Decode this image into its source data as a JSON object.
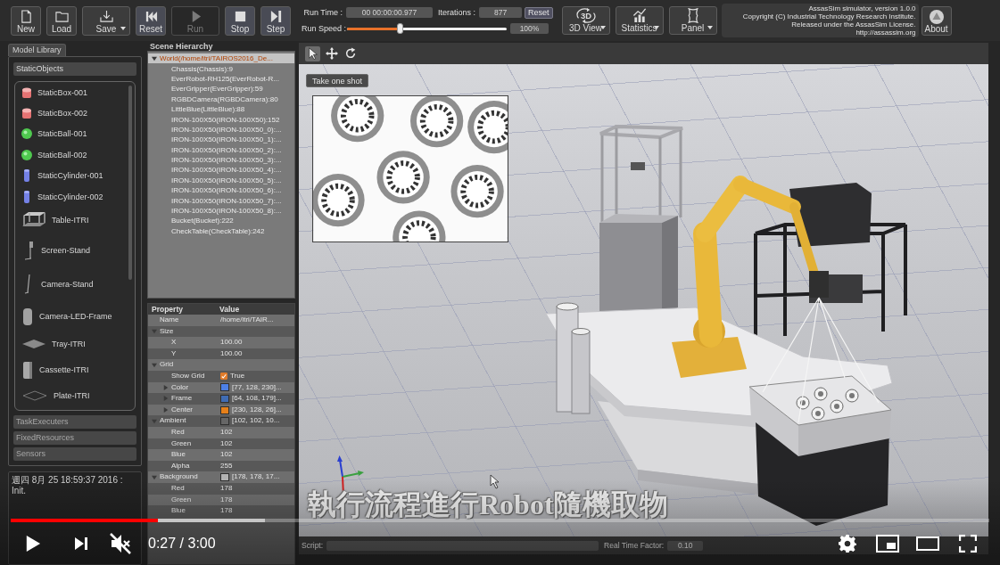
{
  "toolbar": {
    "buttons": [
      {
        "kind": "new",
        "label": "New",
        "menu": false,
        "disabled": false
      },
      {
        "kind": "load",
        "label": "Load",
        "menu": false,
        "disabled": false
      },
      {
        "kind": "save",
        "label": "Save",
        "menu": true,
        "disabled": false
      },
      {
        "kind": "reset",
        "label": "Reset",
        "menu": false,
        "disabled": false
      },
      {
        "kind": "run",
        "label": "Run",
        "menu": false,
        "disabled": true
      },
      {
        "kind": "stop",
        "label": "Stop",
        "menu": false,
        "disabled": false
      },
      {
        "kind": "step",
        "label": "Step",
        "menu": false,
        "disabled": false
      }
    ],
    "run_time": {
      "label": "Run Time :",
      "value": "00 00:00:00.977"
    },
    "iterations": {
      "label": "Iterations :",
      "value": "877"
    },
    "reset_button": "Reset",
    "run_speed": {
      "label": "Run Speed :",
      "level": 0.33,
      "value": "100%"
    },
    "view_buttons": [
      {
        "kind": "view",
        "label": "3D View",
        "icon_text": "3D",
        "menu": true
      },
      {
        "kind": "statistics",
        "label": "Statistics",
        "menu": true
      },
      {
        "kind": "panel",
        "label": "Panel",
        "menu": true
      }
    ],
    "info_lines": [
      "AssasSim simulator, version 1.0.0",
      "Copyright (C) Industrial Technology Research Institute.",
      "Released under the AssasSim License.",
      "http://assassim.org"
    ],
    "about_button": "About"
  },
  "model_library": {
    "tab": "Model Library",
    "sections": [
      {
        "title": "StaticObjects",
        "expanded": true,
        "items": [
          {
            "kind": "box",
            "label": "StaticBox-001"
          },
          {
            "kind": "box",
            "label": "StaticBox-002"
          },
          {
            "kind": "ball",
            "label": "StaticBall-001"
          },
          {
            "kind": "ball",
            "label": "StaticBall-002"
          },
          {
            "kind": "cylinder",
            "label": "StaticCylinder-001"
          },
          {
            "kind": "cylinder",
            "label": "StaticCylinder-002"
          },
          {
            "kind": "table",
            "label": "Table-ITRI"
          },
          {
            "kind": "screen-stand",
            "label": "Screen-Stand"
          },
          {
            "kind": "camera-stand",
            "label": "Camera-Stand"
          },
          {
            "kind": "frame",
            "label": "Camera-LED-Frame"
          },
          {
            "kind": "tray",
            "label": "Tray-ITRI"
          },
          {
            "kind": "cassette",
            "label": "Cassette-ITRI"
          },
          {
            "kind": "plate",
            "label": "Plate-ITRI"
          }
        ]
      },
      {
        "title": "TaskExecuters",
        "expanded": false
      },
      {
        "title": "FixedResources",
        "expanded": false
      },
      {
        "title": "Sensors",
        "expanded": false
      }
    ]
  },
  "log": [
    "週四 8月 25 18:59:37 2016 : Init."
  ],
  "scene_hierarchy": {
    "title": "Scene Hierarchy",
    "tree": [
      {
        "label": "World(/home/itri/TAIROS2016_De...",
        "selected": true,
        "expanded": true,
        "children": [
          {
            "label": "Chassis(Chassis):9",
            "selected": false
          },
          {
            "label": "EverRobot-RH125(EverRobot-R...",
            "selected": false
          },
          {
            "label": "EverGripper(EverGripper):59",
            "selected": false
          },
          {
            "label": "RGBDCamera(RGBDCamera):80",
            "selected": false
          },
          {
            "label": "LittleBlue(LittleBlue):88",
            "selected": false
          },
          {
            "label": "IRON-100X50(IRON-100X50):152",
            "selected": false
          },
          {
            "label": "IRON-100X50(IRON-100X50_0):...",
            "selected": false
          },
          {
            "label": "IRON-100X50(IRON-100X50_1):...",
            "selected": false
          },
          {
            "label": "IRON-100X50(IRON-100X50_2):...",
            "selected": false
          },
          {
            "label": "IRON-100X50(IRON-100X50_3):...",
            "selected": false
          },
          {
            "label": "IRON-100X50(IRON-100X50_4):...",
            "selected": false
          },
          {
            "label": "IRON-100X50(IRON-100X50_5):...",
            "selected": false
          },
          {
            "label": "IRON-100X50(IRON-100X50_6):...",
            "selected": false
          },
          {
            "label": "IRON-100X50(IRON-100X50_7):...",
            "selected": false
          },
          {
            "label": "IRON-100X50(IRON-100X50_8):...",
            "selected": false
          },
          {
            "label": "Bucket(Bucket):222",
            "selected": false
          },
          {
            "label": "CheckTable(CheckTable):242",
            "selected": false
          }
        ]
      }
    ]
  },
  "properties": {
    "columns": [
      "Property",
      "Value"
    ],
    "rows": [
      {
        "name": "Name",
        "value": "/home/itri/TAIR..."
      },
      {
        "name": "Size",
        "expanded": true,
        "children": [
          {
            "name": "X",
            "value": "100.00"
          },
          {
            "name": "Y",
            "value": "100.00"
          }
        ]
      },
      {
        "name": "Grid",
        "expanded": true,
        "children": [
          {
            "name": "Show Grid",
            "checked": true,
            "value": "True"
          },
          {
            "name": "Color",
            "expanded": false,
            "color": "#4d80e6",
            "value": "[77, 128, 230]..."
          },
          {
            "name": "Frame",
            "expanded": false,
            "color": "#406cb3",
            "value": "[64, 108, 179]..."
          },
          {
            "name": "Center",
            "expanded": false,
            "color": "#e6801a",
            "value": "[230, 128, 26]..."
          }
        ]
      },
      {
        "name": "Ambient",
        "expanded": true,
        "color": "#666666",
        "value": "[102, 102, 10...",
        "children": [
          {
            "name": "Red",
            "value": "102"
          },
          {
            "name": "Green",
            "value": "102"
          },
          {
            "name": "Blue",
            "value": "102"
          },
          {
            "name": "Alpha",
            "value": "255"
          }
        ]
      },
      {
        "name": "Background",
        "expanded": true,
        "color": "#b2b2b2",
        "value": "[178, 178, 17...",
        "children": [
          {
            "name": "Red",
            "value": "178"
          },
          {
            "name": "Green",
            "value": "178"
          },
          {
            "name": "Blue",
            "value": "178"
          }
        ]
      }
    ]
  },
  "viewport": {
    "tools": [
      {
        "kind": "select",
        "selected": true
      },
      {
        "kind": "move",
        "selected": false
      },
      {
        "kind": "rotate",
        "selected": false
      }
    ],
    "snapshot_button": "Take one shot",
    "caption": "執行流程進行Robot隨機取物",
    "status": {
      "script_label": "Script:",
      "rtf_label": "Real Time Factor:",
      "rtf_value": "0.10"
    }
  },
  "player": {
    "progress": {
      "level": 0.15
    },
    "buffer": {
      "level": 0.26
    },
    "playing": false,
    "muted": true,
    "time": "0:27 / 3:00"
  }
}
